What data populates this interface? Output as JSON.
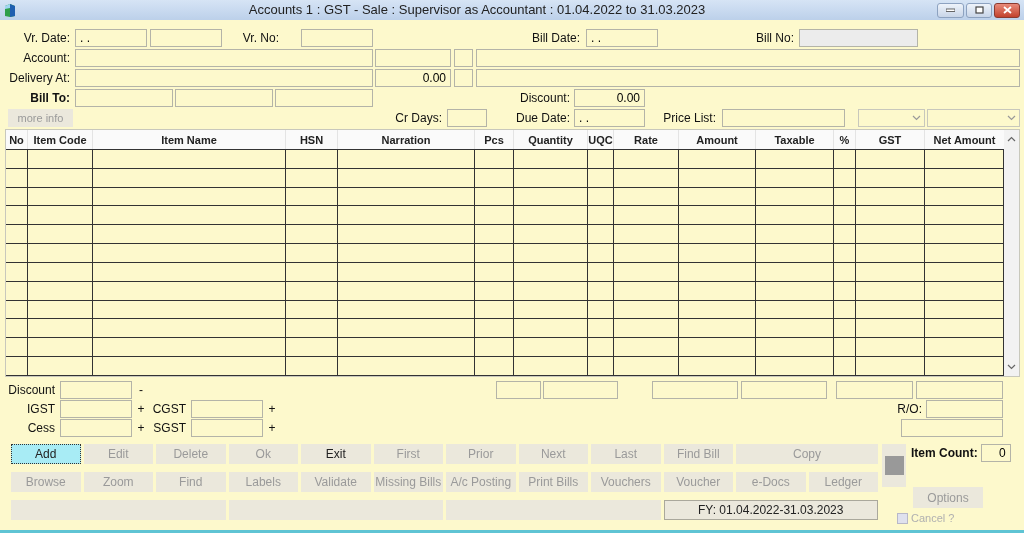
{
  "window": {
    "title": "Accounts 1 : GST -  Sale : Supervisor as Accountant : 01.04.2022 to 31.03.2023"
  },
  "header": {
    "vr_date": {
      "label": "Vr. Date:",
      "value": ". ."
    },
    "vr_no": {
      "label": "Vr. No:"
    },
    "bill_date": {
      "label": "Bill Date:",
      "value": ". ."
    },
    "bill_no": {
      "label": "Bill No:",
      "disabled": true
    },
    "account": {
      "label": "Account:"
    },
    "delivery_at": {
      "label": "Delivery At:",
      "value": "0.00"
    },
    "bill_to": {
      "label": "Bill To:"
    },
    "discount": {
      "label": "Discount:",
      "value": "0.00"
    },
    "more_info": {
      "label": "more info",
      "disabled": true
    },
    "cr_days": {
      "label": "Cr Days:"
    },
    "due_date": {
      "label": "Due Date:",
      "value": ". ."
    },
    "price_list": {
      "label": "Price List:"
    }
  },
  "table": {
    "columns": [
      "No",
      "Item Code",
      "Item Name",
      "HSN",
      "Narration",
      "Pcs",
      "Quantity",
      "UQC",
      "Rate",
      "Amount",
      "Taxable",
      "%",
      "GST",
      "Net Amount"
    ]
  },
  "totals": {
    "discount": {
      "label": "Discount",
      "sign": "-"
    },
    "igst": {
      "label": "IGST",
      "sign": "+"
    },
    "cgst": {
      "label": "CGST",
      "sign": "+"
    },
    "cess": {
      "label": "Cess",
      "sign": "+"
    },
    "sgst": {
      "label": "SGST",
      "sign": "+"
    },
    "ro": {
      "label": "R/O:"
    },
    "item_count": {
      "label": "Item Count:",
      "value": "0"
    }
  },
  "buttons": [
    [
      {
        "label": "Add",
        "disabled": false,
        "focused": true
      },
      {
        "label": "Edit",
        "disabled": true,
        "focused": false
      },
      {
        "label": "Delete",
        "disabled": true,
        "focused": false
      },
      {
        "label": "Ok",
        "disabled": true,
        "focused": false
      },
      {
        "label": "Exit",
        "disabled": false,
        "focused": false
      },
      {
        "label": "First",
        "disabled": true,
        "focused": false
      },
      {
        "label": "Prior",
        "disabled": true,
        "focused": false
      },
      {
        "label": "Next",
        "disabled": true,
        "focused": false
      },
      {
        "label": "Last",
        "disabled": true,
        "focused": false
      },
      {
        "label": "Find Bill",
        "disabled": true,
        "focused": false
      },
      {
        "label": "Copy",
        "disabled": true,
        "focused": false,
        "kind": "wide"
      }
    ],
    [
      {
        "label": "Browse",
        "disabled": true,
        "focused": false
      },
      {
        "label": "Zoom",
        "disabled": true,
        "focused": false
      },
      {
        "label": "Find",
        "disabled": true,
        "focused": false
      },
      {
        "label": "Labels",
        "disabled": true,
        "focused": false
      },
      {
        "label": "Validate",
        "disabled": true,
        "focused": false
      },
      {
        "label": "Missing Bills",
        "disabled": true,
        "focused": false
      },
      {
        "label": "A/c Posting",
        "disabled": true,
        "focused": false
      },
      {
        "label": "Print Bills",
        "disabled": true,
        "focused": false
      },
      {
        "label": "Vouchers",
        "disabled": true,
        "focused": false
      },
      {
        "label": "Voucher",
        "disabled": true,
        "focused": false
      },
      {
        "label": "e-Docs",
        "disabled": true,
        "focused": false
      },
      {
        "label": "Ledger",
        "disabled": true,
        "focused": false,
        "kind": "small"
      }
    ]
  ],
  "fy_button": {
    "label": "FY: 01.04.2022-31.03.2023"
  },
  "options_button": {
    "label": "Options",
    "disabled": true
  },
  "cancel": {
    "label": "Cancel ?",
    "checked": false,
    "disabled": true
  }
}
